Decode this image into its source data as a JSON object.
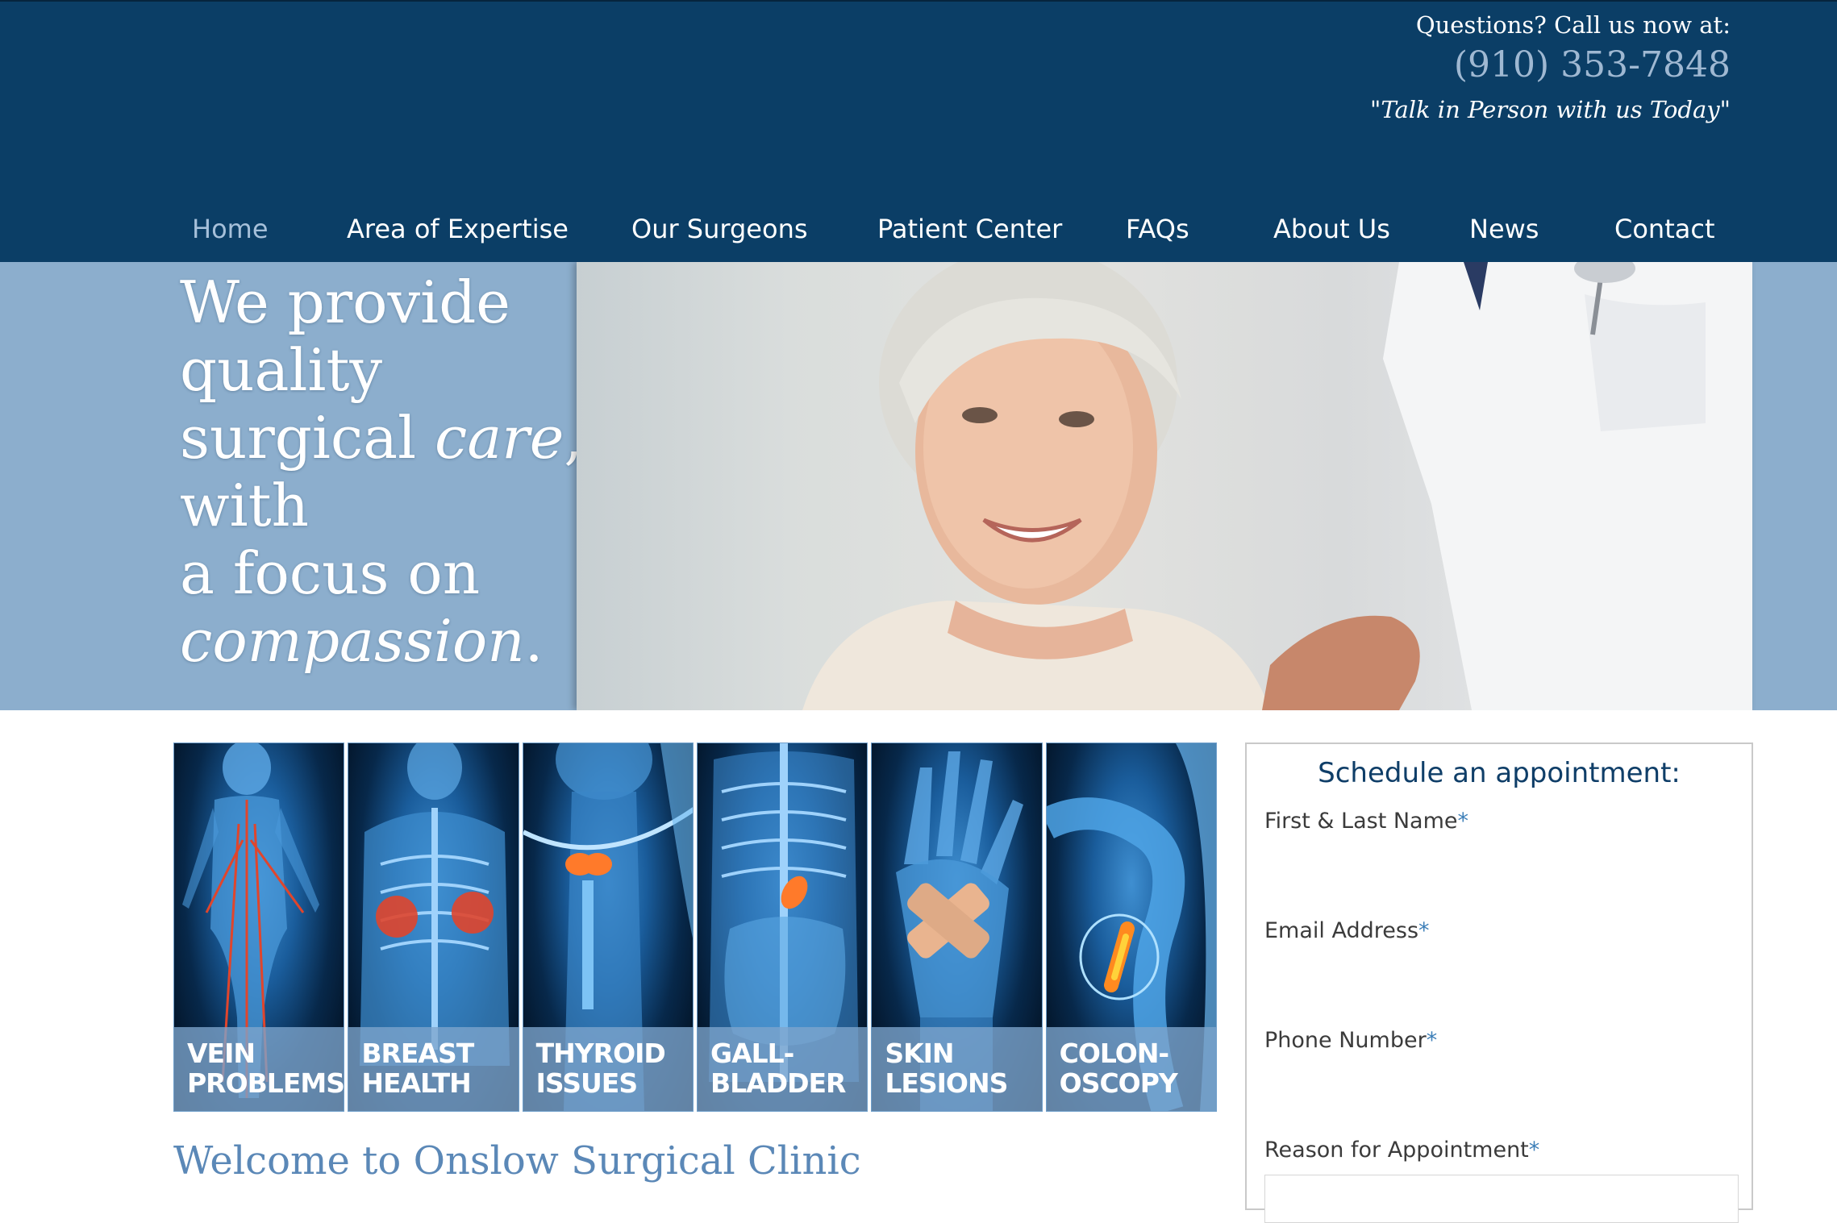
{
  "header": {
    "question": "Questions? Call us now at:",
    "phone": "(910) 353-7848",
    "tagline": "\"Talk in Person with us Today\""
  },
  "nav": {
    "items": [
      {
        "label": "Home",
        "active": true
      },
      {
        "label": "Area of Expertise",
        "active": false
      },
      {
        "label": "Our Surgeons",
        "active": false
      },
      {
        "label": "Patient Center",
        "active": false
      },
      {
        "label": "FAQs",
        "active": false
      },
      {
        "label": "About Us",
        "active": false
      },
      {
        "label": "News",
        "active": false
      },
      {
        "label": "Contact",
        "active": false
      }
    ]
  },
  "hero": {
    "line1": "We provide",
    "line2": "quality",
    "line3a": "surgical ",
    "line3b": "care",
    "line3c": ",",
    "line4": "with",
    "line5": "a focus on",
    "line6a": "compassion",
    "line6b": "."
  },
  "tiles": [
    {
      "line1": "VEIN",
      "line2": "PROBLEMS"
    },
    {
      "line1": "BREAST",
      "line2": "HEALTH"
    },
    {
      "line1": "THYROID",
      "line2": "ISSUES"
    },
    {
      "line1": "GALL-",
      "line2": "BLADDER"
    },
    {
      "line1": "SKIN",
      "line2": "LESIONS"
    },
    {
      "line1": "COLON-",
      "line2": "OSCOPY"
    }
  ],
  "welcome": "Welcome to Onslow Surgical Clinic",
  "appointment": {
    "title": "Schedule an appointment:",
    "required_mark": "*",
    "fields": [
      {
        "label": "First & Last Name"
      },
      {
        "label": "Email Address"
      },
      {
        "label": "Phone Number"
      },
      {
        "label": "Reason for Appointment"
      }
    ]
  },
  "colors": {
    "header_bg": "#0b3e66",
    "hero_bg": "#8caecd",
    "nav_active": "#a6c0da",
    "welcome_text": "#5b88b7"
  }
}
